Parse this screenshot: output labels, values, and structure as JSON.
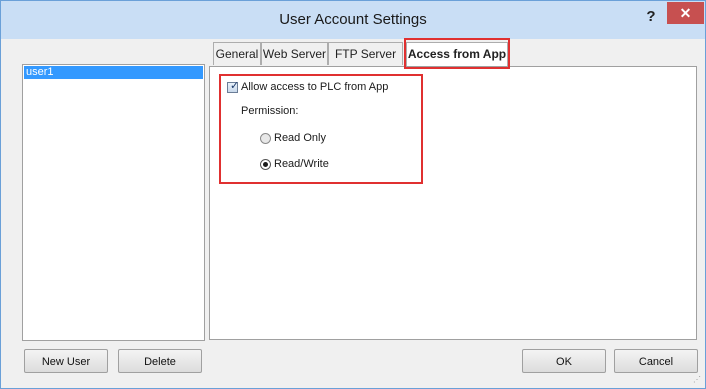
{
  "window": {
    "title": "User Account Settings",
    "help_glyph": "?",
    "close_glyph": "✕"
  },
  "users": {
    "items": [
      {
        "label": "user1",
        "selected": true
      }
    ]
  },
  "tabs": [
    {
      "label": "General"
    },
    {
      "label": "Web Server"
    },
    {
      "label": "FTP Server"
    },
    {
      "label": "Access from App",
      "active": true
    }
  ],
  "panel": {
    "allow_access_label": "Allow access to PLC from App",
    "allow_access_checked": true,
    "permission_label": "Permission:",
    "options": [
      {
        "label": "Read Only",
        "checked": false
      },
      {
        "label": "Read/Write",
        "checked": true
      }
    ]
  },
  "buttons": {
    "new_user": "New User",
    "delete": "Delete",
    "ok": "OK",
    "cancel": "Cancel"
  },
  "colors": {
    "selection": "#3399ff",
    "highlight_border": "#e03030",
    "title_bar": "#c9def5",
    "close_button": "#c75050"
  }
}
